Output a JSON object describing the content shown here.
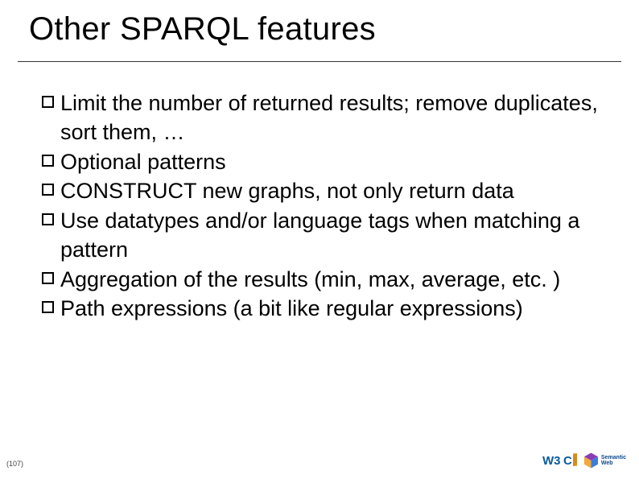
{
  "title": "Other SPARQL features",
  "bullets": [
    "Limit the number of returned results; remove duplicates, sort them, …",
    "Optional patterns",
    "CONSTRUCT new graphs, not only return data",
    "Use datatypes and/or language tags when matching a pattern",
    "Aggregation of the results (min, max, average, etc. )",
    "Path expressions (a bit like regular expressions)"
  ],
  "page_number": "(107)",
  "logos": {
    "w3c_label": "W3C",
    "sw_line1": "Semantic",
    "sw_line2": "Web"
  }
}
